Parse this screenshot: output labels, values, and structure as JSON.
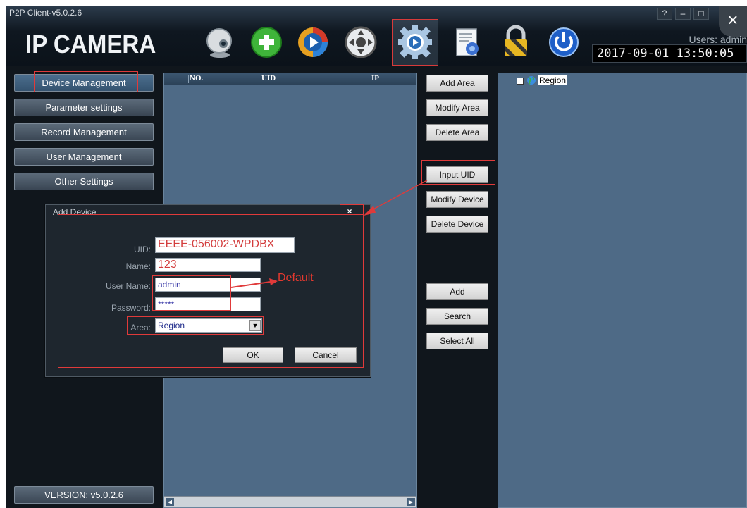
{
  "window": {
    "title": "P2P Client-v5.0.2.6",
    "logo": "IP CAMERA",
    "help_label": "?",
    "minimize_label": "–",
    "maximize_label": "□",
    "close_label": "×",
    "users_text": "Users: admin",
    "datetime": "2017-09-01  13:50:05"
  },
  "toolbar": {
    "icons": [
      "webcam-icon",
      "add-icon",
      "playback-icon",
      "ptz-icon",
      "settings-icon",
      "log-icon",
      "lock-icon",
      "power-icon"
    ],
    "active": "settings-icon"
  },
  "sidebar": {
    "items": [
      {
        "label": "Device Management"
      },
      {
        "label": "Parameter settings"
      },
      {
        "label": "Record Management"
      },
      {
        "label": "User Management"
      },
      {
        "label": "Other Settings"
      }
    ],
    "selected": "Device Management",
    "version": "VERSION: v5.0.2.6"
  },
  "device_table": {
    "columns": [
      "NO.",
      "UID",
      "IP"
    ],
    "rows": []
  },
  "actions": {
    "add_area": "Add Area",
    "modify_area": "Modify Area",
    "delete_area": "Delete Area",
    "input_uid": "Input UID",
    "modify_device": "Modify Device",
    "delete_device": "Delete Device",
    "add": "Add",
    "search": "Search",
    "select_all": "Select All"
  },
  "tree": {
    "root_label": "Region"
  },
  "dialog": {
    "title": "Add Device",
    "close_label": "×",
    "uid_label": "UID:",
    "uid_value": "EEEE-056002-WPDBX",
    "name_label": "Name:",
    "name_value": "123",
    "username_label": "User Name:",
    "username_value": "admin",
    "password_label": "Password:",
    "password_value": "*****",
    "area_label": "Area:",
    "area_value": "Region",
    "ok_label": "OK",
    "cancel_label": "Cancel"
  },
  "annotation": {
    "default_text": "Default",
    "color": "#e03a3a"
  },
  "colors": {
    "panel": "#4e6a86",
    "header": "#0a1118",
    "annotation": "#e03a3a"
  }
}
